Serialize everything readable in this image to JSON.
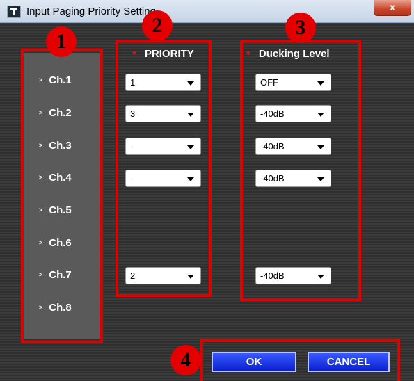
{
  "window": {
    "title": "Input Paging Priority Setting",
    "close_label": "x"
  },
  "channels": [
    "Ch.1",
    "Ch.2",
    "Ch.3",
    "Ch.4",
    "Ch.5",
    "Ch.6",
    "Ch.7",
    "Ch.8"
  ],
  "headers": {
    "priority": "PRIORITY",
    "ducking": "Ducking Level"
  },
  "priority_values": {
    "ch1": "1",
    "ch2": "3",
    "ch3": "-",
    "ch4": "-",
    "ch7": "2"
  },
  "ducking_values": {
    "ch1": "OFF",
    "ch2": "-40dB",
    "ch3": "-40dB",
    "ch4": "-40dB",
    "ch7": "-40dB"
  },
  "buttons": {
    "ok": "OK",
    "cancel": "CANCEL"
  },
  "annotations": [
    "1",
    "2",
    "3",
    "4"
  ],
  "colors": {
    "annotation": "#e00000",
    "button": "#1a33e8",
    "header_marker": "#c91a1a"
  }
}
